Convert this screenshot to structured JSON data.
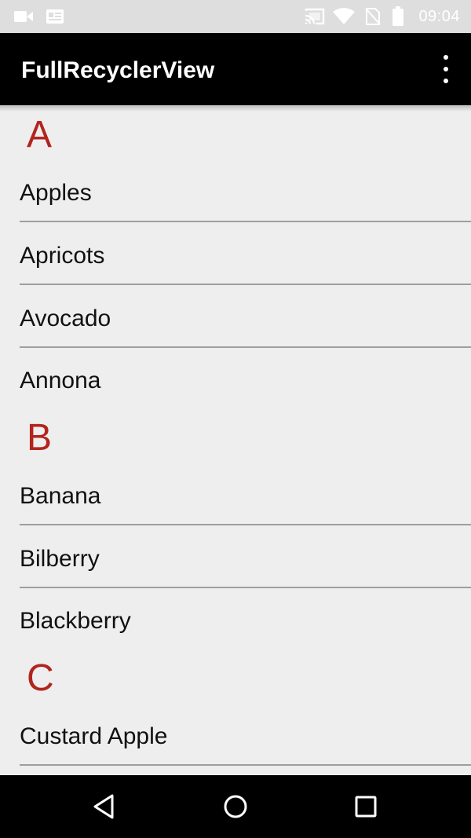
{
  "status_bar": {
    "time": "09:04",
    "left_icons": [
      "video-camera-icon",
      "news-notification-icon"
    ],
    "right_icons": [
      "cast-icon",
      "wifi-icon",
      "no-sim-icon",
      "battery-icon"
    ]
  },
  "app_bar": {
    "title": "FullRecyclerView",
    "menu_icon": "more-vertical-icon"
  },
  "sections": [
    {
      "letter": "A",
      "items": [
        "Apples",
        "Apricots",
        "Avocado",
        "Annona"
      ]
    },
    {
      "letter": "B",
      "items": [
        "Banana",
        "Bilberry",
        "Blackberry"
      ]
    },
    {
      "letter": "C",
      "items": [
        "Custard Apple"
      ]
    }
  ],
  "nav_bar": {
    "buttons": [
      "back-icon",
      "home-icon",
      "recents-icon"
    ]
  },
  "colors": {
    "section_header": "#b3241f",
    "app_bar": "#000000",
    "background": "#eeeeee"
  }
}
